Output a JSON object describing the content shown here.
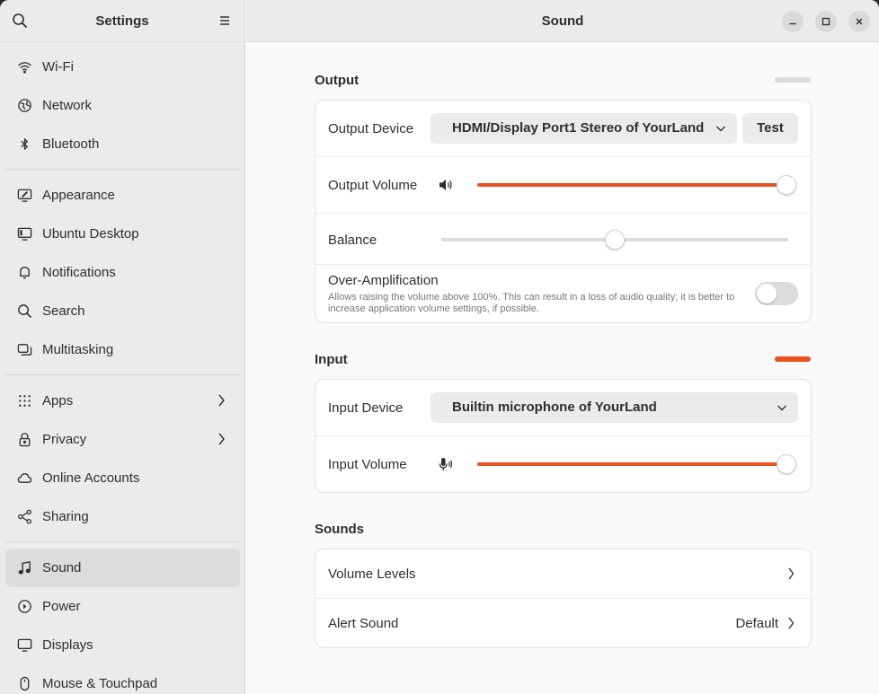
{
  "sidebar": {
    "title": "Settings",
    "search_icon": "search-icon",
    "menu_icon": "hamburger-menu-icon",
    "groups": [
      [
        {
          "label": "Wi-Fi",
          "icon": "wifi-icon"
        },
        {
          "label": "Network",
          "icon": "network-icon"
        },
        {
          "label": "Bluetooth",
          "icon": "bluetooth-icon"
        }
      ],
      [
        {
          "label": "Appearance",
          "icon": "appearance-icon"
        },
        {
          "label": "Ubuntu Desktop",
          "icon": "ubuntu-desktop-icon"
        },
        {
          "label": "Notifications",
          "icon": "bell-icon"
        },
        {
          "label": "Search",
          "icon": "search-icon"
        },
        {
          "label": "Multitasking",
          "icon": "multitasking-icon"
        }
      ],
      [
        {
          "label": "Apps",
          "icon": "apps-grid-icon",
          "has_chevron": true
        },
        {
          "label": "Privacy",
          "icon": "lock-icon",
          "has_chevron": true
        },
        {
          "label": "Online Accounts",
          "icon": "cloud-icon"
        },
        {
          "label": "Sharing",
          "icon": "share-icon"
        }
      ],
      [
        {
          "label": "Sound",
          "icon": "music-note-icon",
          "active": true
        },
        {
          "label": "Power",
          "icon": "power-icon"
        },
        {
          "label": "Displays",
          "icon": "display-icon"
        },
        {
          "label": "Mouse & Touchpad",
          "icon": "mouse-icon"
        }
      ]
    ]
  },
  "header": {
    "title": "Sound"
  },
  "output": {
    "section_title": "Output",
    "level": 0.0,
    "device_label": "Output Device",
    "device_value": "HDMI/Display Port1 Stereo of YourLand",
    "test_label": "Test",
    "volume_label": "Output Volume",
    "volume": 1.0,
    "balance_label": "Balance",
    "balance": 0.5,
    "over_amp_label": "Over-Amplification",
    "over_amp_desc": "Allows raising the volume above 100%. This can result in a loss of audio quality; it is better to increase application volume settings, if possible.",
    "over_amp_enabled": false
  },
  "input": {
    "section_title": "Input",
    "level": 1.0,
    "device_label": "Input Device",
    "device_value": "Builtin microphone of YourLand",
    "volume_label": "Input Volume",
    "volume": 1.0
  },
  "sounds": {
    "section_title": "Sounds",
    "volume_levels_label": "Volume Levels",
    "alert_sound_label": "Alert Sound",
    "alert_sound_value": "Default"
  },
  "colors": {
    "accent": "#e95420",
    "sidebar_bg": "#ebebeb",
    "active_item_bg": "#dcdcdc"
  }
}
